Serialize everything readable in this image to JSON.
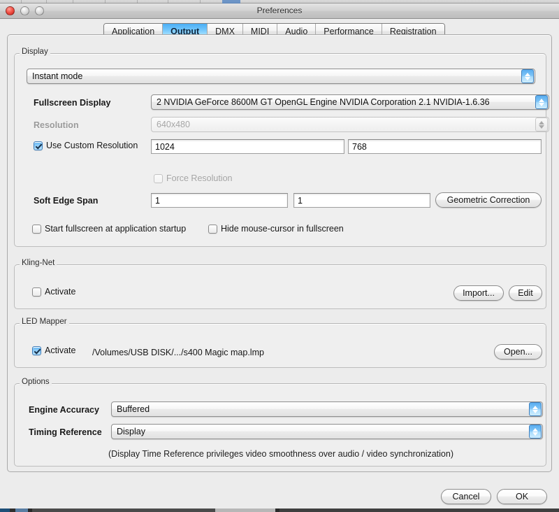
{
  "window": {
    "title": "Preferences",
    "controls": [
      "close",
      "minimize",
      "zoom"
    ]
  },
  "tabs": [
    {
      "label": "Application",
      "active": false
    },
    {
      "label": "Output",
      "active": true
    },
    {
      "label": "DMX",
      "active": false
    },
    {
      "label": "MIDI",
      "active": false
    },
    {
      "label": "Audio",
      "active": false
    },
    {
      "label": "Performance",
      "active": false
    },
    {
      "label": "Registration",
      "active": false
    }
  ],
  "display": {
    "group_label": "Display",
    "mode_popup": {
      "value": "Instant mode"
    },
    "fullscreen_display": {
      "label": "Fullscreen Display",
      "value": "2 NVIDIA GeForce 8600M GT OpenGL Engine NVIDIA Corporation 2.1 NVIDIA-1.6.36"
    },
    "resolution": {
      "label": "Resolution",
      "value": "640x480",
      "enabled": false
    },
    "use_custom_resolution": {
      "label": "Use Custom Resolution",
      "checked": true,
      "width": "1024",
      "height": "768"
    },
    "force_resolution": {
      "label": "Force Resolution",
      "checked": false,
      "enabled": false
    },
    "soft_edge_span": {
      "label": "Soft Edge Span",
      "value_x": "1",
      "value_y": "1"
    },
    "geometric_correction_button": "Geometric Correction",
    "start_fullscreen": {
      "label": "Start fullscreen at application startup",
      "checked": false
    },
    "hide_cursor": {
      "label": "Hide mouse-cursor in fullscreen",
      "checked": false
    }
  },
  "kling_net": {
    "group_label": "Kling-Net",
    "activate": {
      "label": "Activate",
      "checked": false
    },
    "import_button": "Import...",
    "edit_button": "Edit"
  },
  "led_mapper": {
    "group_label": "LED Mapper",
    "activate": {
      "label": "Activate",
      "checked": true
    },
    "path": "/Volumes/USB DISK/.../s400 Magic map.lmp",
    "open_button": "Open..."
  },
  "options": {
    "group_label": "Options",
    "engine_accuracy": {
      "label": "Engine Accuracy",
      "value": "Buffered"
    },
    "timing_reference": {
      "label": "Timing Reference",
      "value": "Display"
    },
    "note": "(Display Time Reference privileges video smoothness over audio / video synchronization)"
  },
  "footer": {
    "cancel_button": "Cancel",
    "ok_button": "OK"
  },
  "colors": {
    "accent_blue": "#7fc5f7",
    "tab_active_blue": "#6ec4fb",
    "window_bg": "#ececec",
    "close_red": "#f4564a"
  }
}
